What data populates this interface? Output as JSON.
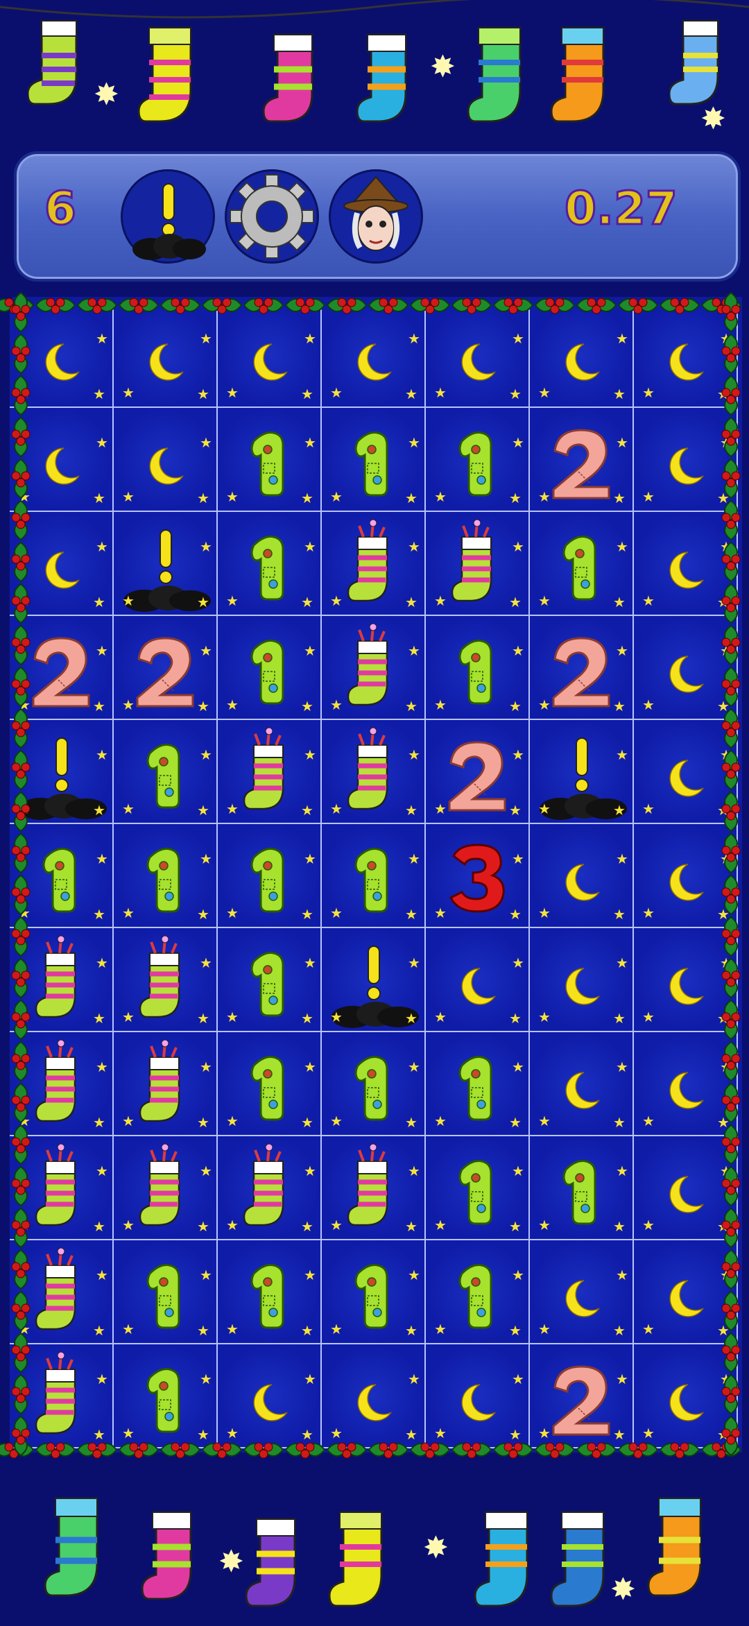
{
  "hud": {
    "mines_left": "6",
    "timer": "0.27"
  },
  "buttons": {
    "hint": "hint-bomb-icon",
    "settings": "gear-icon",
    "character": "witch-icon"
  },
  "colors": {
    "one": "#a6e22e",
    "two": "#f4a59a",
    "three": "#e01a1a",
    "moon": "#f5e21a",
    "board": "#0f1aa0"
  },
  "board": {
    "rows": [
      [
        "moon",
        "moon",
        "moon",
        "moon",
        "moon",
        "moon",
        "moon"
      ],
      [
        "moon",
        "moon",
        "1",
        "1",
        "1",
        "2",
        "moon"
      ],
      [
        "moon",
        "bomb",
        "1",
        "sock",
        "sock",
        "1",
        "moon"
      ],
      [
        "2",
        "2",
        "1",
        "sock",
        "1",
        "2",
        "moon"
      ],
      [
        "bomb",
        "1",
        "sock",
        "sock",
        "2",
        "bomb",
        "moon"
      ],
      [
        "1",
        "1",
        "1",
        "1",
        "3",
        "moon",
        "moon"
      ],
      [
        "sock",
        "sock",
        "1",
        "bomb",
        "moon",
        "moon",
        "moon"
      ],
      [
        "sock",
        "sock",
        "1",
        "1",
        "1",
        "moon",
        "moon"
      ],
      [
        "sock",
        "sock",
        "sock",
        "sock",
        "1",
        "1",
        "moon"
      ],
      [
        "sock",
        "1",
        "1",
        "1",
        "1",
        "moon",
        "moon"
      ],
      [
        "sock",
        "1",
        "moon",
        "moon",
        "moon",
        "2",
        "moon"
      ]
    ]
  }
}
